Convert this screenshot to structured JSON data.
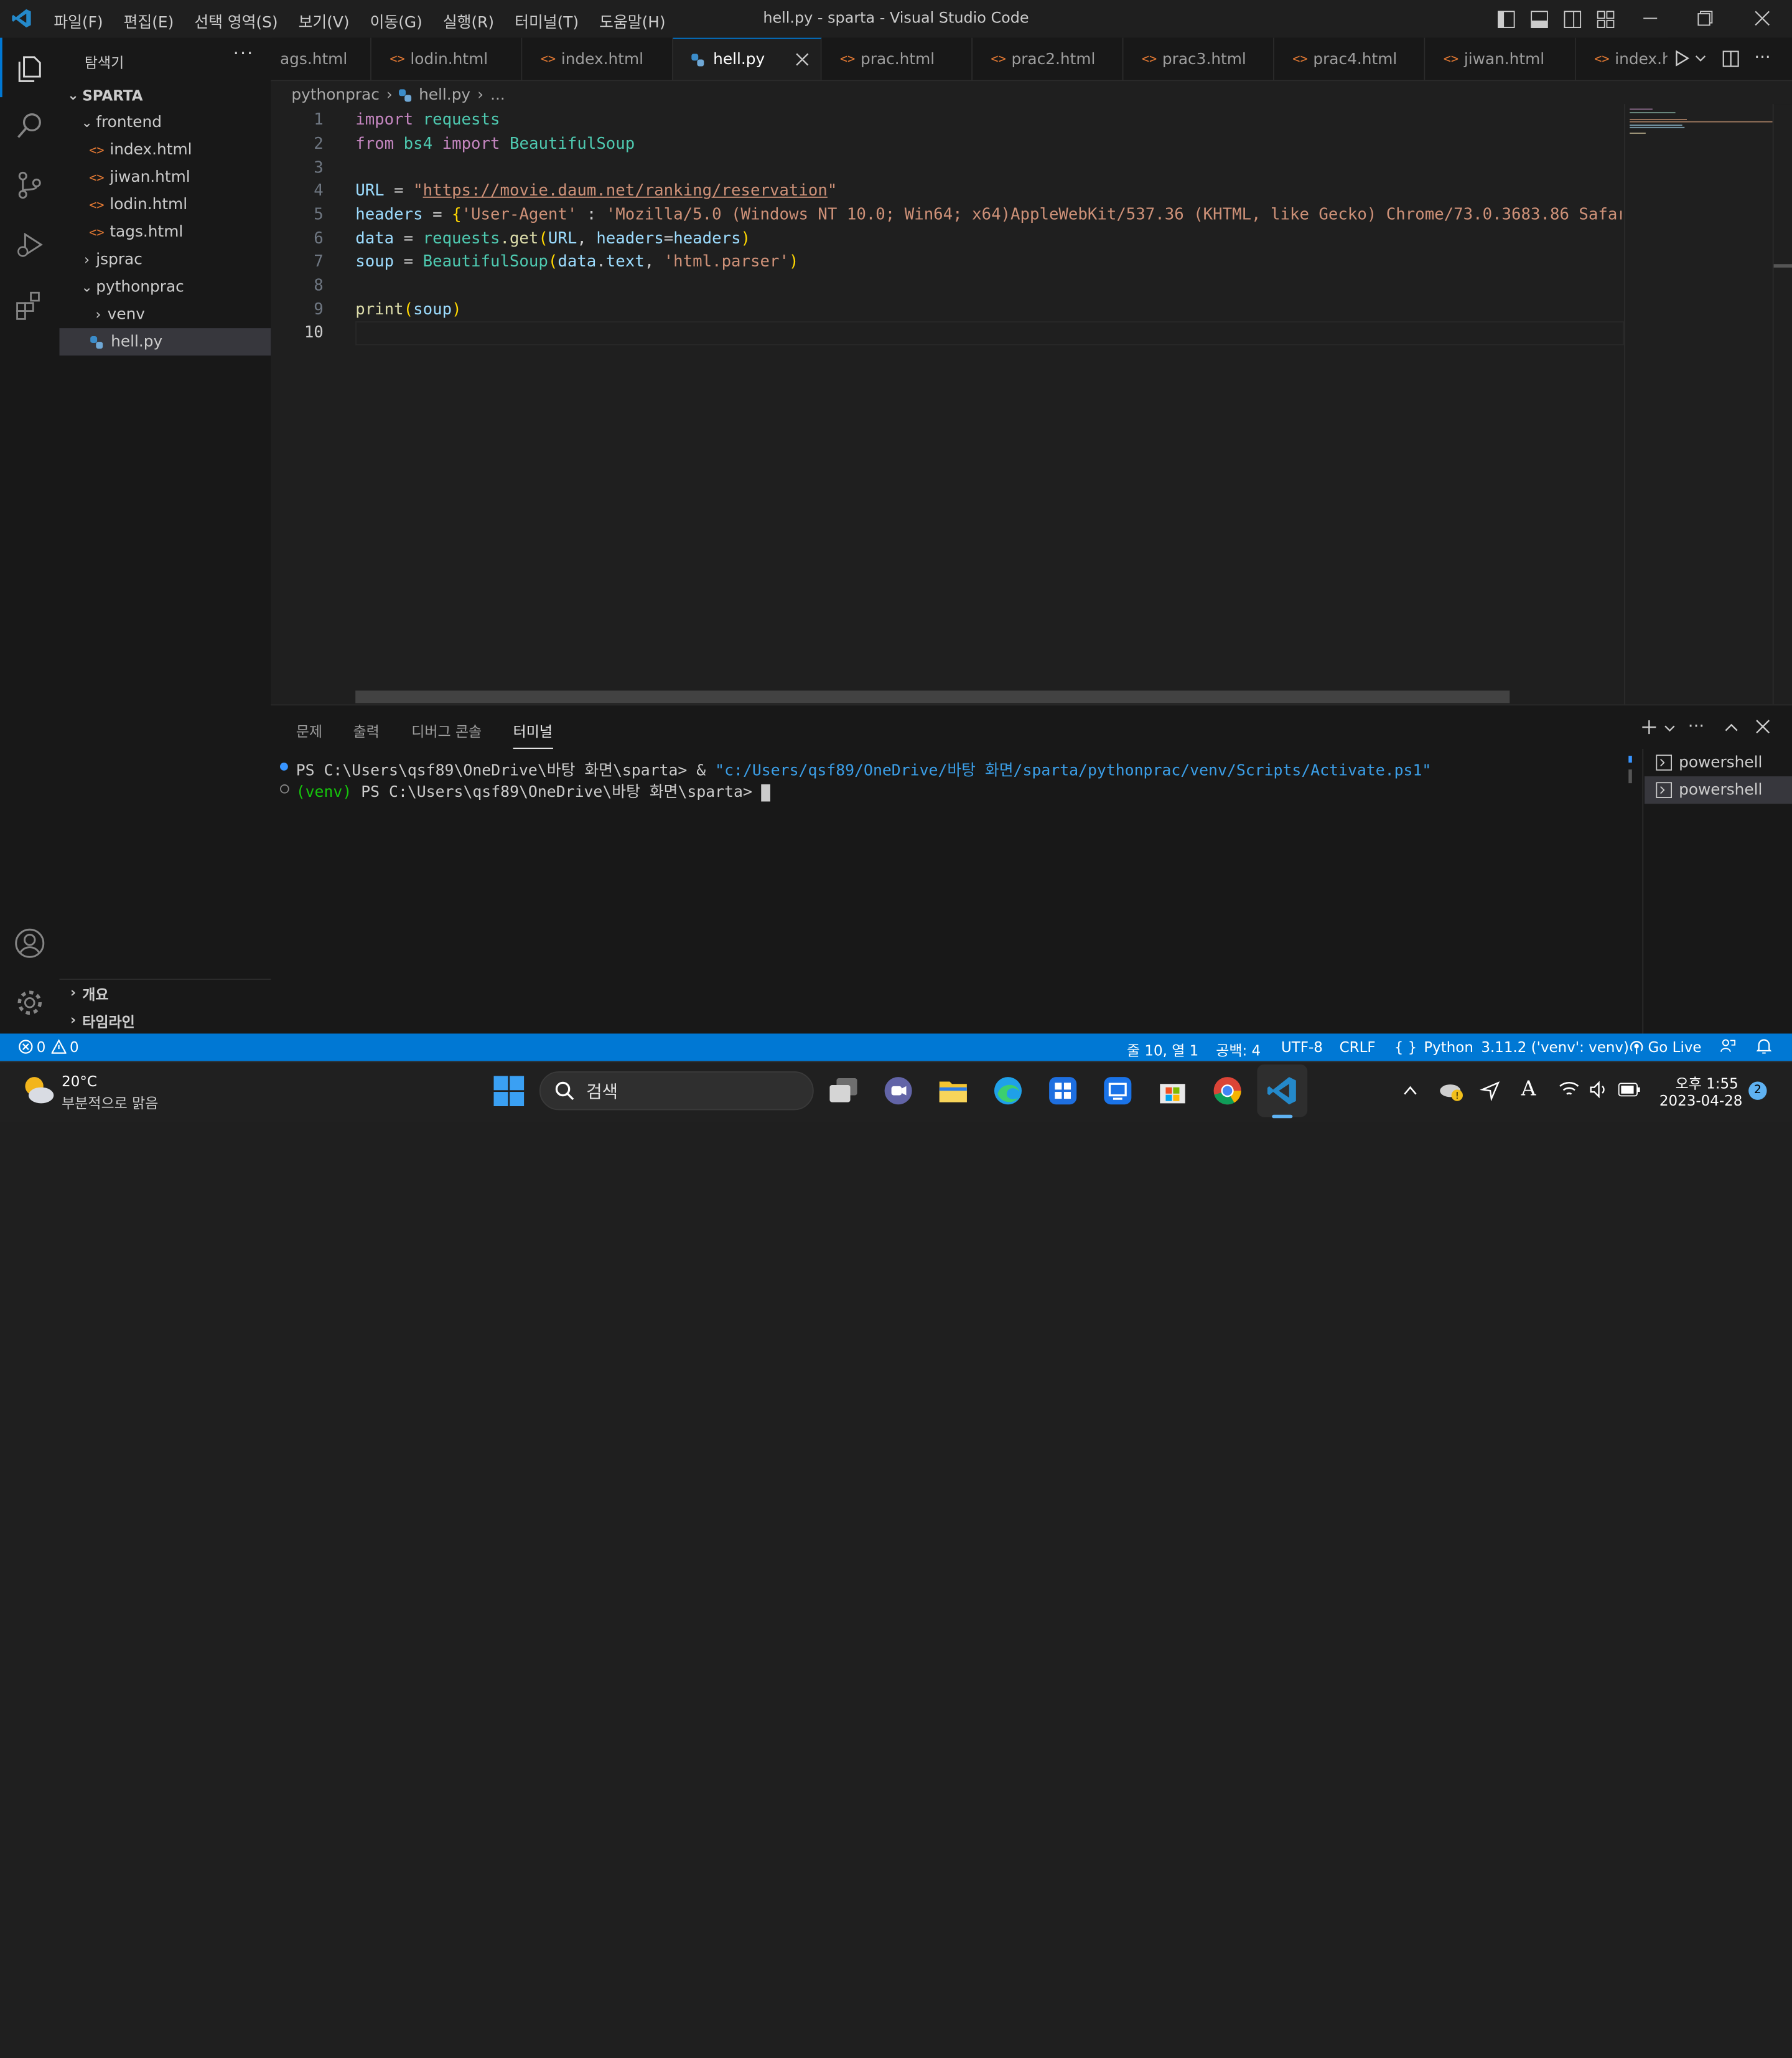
{
  "titlebar": {
    "menus": [
      "파일(F)",
      "편집(E)",
      "선택 영역(S)",
      "보기(V)",
      "이동(G)",
      "실행(R)",
      "터미널(T)",
      "도움말(H)"
    ],
    "title": "hell.py - sparta - Visual Studio Code"
  },
  "sidebar": {
    "title": "탐색기",
    "root": "SPARTA",
    "items": [
      {
        "label": "frontend",
        "type": "folder-open"
      },
      {
        "label": "index.html",
        "type": "html"
      },
      {
        "label": "jiwan.html",
        "type": "html"
      },
      {
        "label": "lodin.html",
        "type": "html"
      },
      {
        "label": "tags.html",
        "type": "html"
      },
      {
        "label": "jsprac",
        "type": "folder-closed"
      },
      {
        "label": "pythonprac",
        "type": "folder-open"
      },
      {
        "label": "venv",
        "type": "folder-closed"
      },
      {
        "label": "hell.py",
        "type": "python"
      }
    ],
    "outline": "개요",
    "timeline": "타임라인"
  },
  "tabs": [
    "ags.html",
    "lodin.html",
    "index.html",
    "hell.py",
    "prac.html",
    "prac2.html",
    "prac3.html",
    "prac4.html",
    "jiwan.html",
    "index.h"
  ],
  "breadcrumb": {
    "folder": "pythonprac",
    "file": "hell.py",
    "more": "..."
  },
  "editor": {
    "line_numbers": [
      "1",
      "2",
      "3",
      "4",
      "5",
      "6",
      "7",
      "8",
      "9",
      "10"
    ],
    "lines": {
      "l1_kw": "import",
      "l1_mod": "requests",
      "l2_kw1": "from",
      "l2_mod1": "bs4",
      "l2_kw2": "import",
      "l2_mod2": "BeautifulSoup",
      "l4_var": "URL",
      "l4_eq": " = ",
      "l4_q1": "\"",
      "l4_url": "https://movie.daum.net/ranking/reservation",
      "l4_q2": "\"",
      "l5_var": "headers",
      "l5_eq": " = ",
      "l5_br": "{",
      "l5_key": "'User-Agent'",
      "l5_colon": " : ",
      "l5_val": "'Mozilla/5.0 (Windows NT 10.0; Win64; x64)AppleWebKit/537.36 (KHTML, like Gecko) Chrome/73.0.3683.86 Safari",
      "l6_var": "data",
      "l6_eq": " = ",
      "l6_mod": "requests",
      "l6_fn": ".get",
      "l6_br1": "(",
      "l6_a1": "URL",
      "l6_c": ", ",
      "l6_a2": "headers",
      "l6_eq2": "=",
      "l6_a3": "headers",
      "l6_br2": ")",
      "l7_var": "soup",
      "l7_eq": " = ",
      "l7_cls": "BeautifulSoup",
      "l7_br1": "(",
      "l7_a1": "data",
      "l7_dot": ".",
      "l7_a2": "text",
      "l7_c": ", ",
      "l7_str": "'html.parser'",
      "l7_br2": ")",
      "l9_fn": "print",
      "l9_br1": "(",
      "l9_a": "soup",
      "l9_br2": ")"
    }
  },
  "panel": {
    "tabs": [
      "문제",
      "출력",
      "디버그 콘솔",
      "터미널"
    ],
    "terminal": {
      "line1_prefix": "PS C:\\Users\\qsf89\\OneDrive\\바탕 화면\\sparta> & ",
      "line1_path": "\"c:/Users/qsf89/OneDrive/바탕 화면/sparta/pythonprac/venv/Scripts/Activate.ps1\"",
      "line2_venv": "(venv)",
      "line2_rest": " PS C:\\Users\\qsf89\\OneDrive\\바탕 화면\\sparta> "
    },
    "shells": [
      "powershell",
      "powershell"
    ]
  },
  "statusbar": {
    "errors": "0",
    "warnings": "0",
    "position": "줄 10, 열 1",
    "spaces": "공백: 4",
    "encoding": "UTF-8",
    "eol": "CRLF",
    "language": "Python",
    "interpreter": "3.11.2 ('venv': venv)",
    "golive": "Go Live"
  },
  "taskbar": {
    "weather_temp": "20°C",
    "weather_desc": "부분적으로 맑음",
    "search": "검색",
    "time": "오후 1:55",
    "date": "2023-04-28",
    "notif": "2"
  }
}
